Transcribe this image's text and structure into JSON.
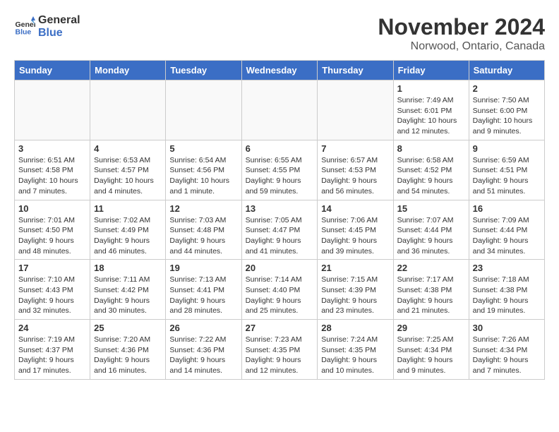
{
  "header": {
    "logo_general": "General",
    "logo_blue": "Blue",
    "title": "November 2024",
    "subtitle": "Norwood, Ontario, Canada"
  },
  "weekdays": [
    "Sunday",
    "Monday",
    "Tuesday",
    "Wednesday",
    "Thursday",
    "Friday",
    "Saturday"
  ],
  "weeks": [
    [
      {
        "day": "",
        "info": ""
      },
      {
        "day": "",
        "info": ""
      },
      {
        "day": "",
        "info": ""
      },
      {
        "day": "",
        "info": ""
      },
      {
        "day": "",
        "info": ""
      },
      {
        "day": "1",
        "info": "Sunrise: 7:49 AM\nSunset: 6:01 PM\nDaylight: 10 hours and 12 minutes."
      },
      {
        "day": "2",
        "info": "Sunrise: 7:50 AM\nSunset: 6:00 PM\nDaylight: 10 hours and 9 minutes."
      }
    ],
    [
      {
        "day": "3",
        "info": "Sunrise: 6:51 AM\nSunset: 4:58 PM\nDaylight: 10 hours and 7 minutes."
      },
      {
        "day": "4",
        "info": "Sunrise: 6:53 AM\nSunset: 4:57 PM\nDaylight: 10 hours and 4 minutes."
      },
      {
        "day": "5",
        "info": "Sunrise: 6:54 AM\nSunset: 4:56 PM\nDaylight: 10 hours and 1 minute."
      },
      {
        "day": "6",
        "info": "Sunrise: 6:55 AM\nSunset: 4:55 PM\nDaylight: 9 hours and 59 minutes."
      },
      {
        "day": "7",
        "info": "Sunrise: 6:57 AM\nSunset: 4:53 PM\nDaylight: 9 hours and 56 minutes."
      },
      {
        "day": "8",
        "info": "Sunrise: 6:58 AM\nSunset: 4:52 PM\nDaylight: 9 hours and 54 minutes."
      },
      {
        "day": "9",
        "info": "Sunrise: 6:59 AM\nSunset: 4:51 PM\nDaylight: 9 hours and 51 minutes."
      }
    ],
    [
      {
        "day": "10",
        "info": "Sunrise: 7:01 AM\nSunset: 4:50 PM\nDaylight: 9 hours and 48 minutes."
      },
      {
        "day": "11",
        "info": "Sunrise: 7:02 AM\nSunset: 4:49 PM\nDaylight: 9 hours and 46 minutes."
      },
      {
        "day": "12",
        "info": "Sunrise: 7:03 AM\nSunset: 4:48 PM\nDaylight: 9 hours and 44 minutes."
      },
      {
        "day": "13",
        "info": "Sunrise: 7:05 AM\nSunset: 4:47 PM\nDaylight: 9 hours and 41 minutes."
      },
      {
        "day": "14",
        "info": "Sunrise: 7:06 AM\nSunset: 4:45 PM\nDaylight: 9 hours and 39 minutes."
      },
      {
        "day": "15",
        "info": "Sunrise: 7:07 AM\nSunset: 4:44 PM\nDaylight: 9 hours and 36 minutes."
      },
      {
        "day": "16",
        "info": "Sunrise: 7:09 AM\nSunset: 4:44 PM\nDaylight: 9 hours and 34 minutes."
      }
    ],
    [
      {
        "day": "17",
        "info": "Sunrise: 7:10 AM\nSunset: 4:43 PM\nDaylight: 9 hours and 32 minutes."
      },
      {
        "day": "18",
        "info": "Sunrise: 7:11 AM\nSunset: 4:42 PM\nDaylight: 9 hours and 30 minutes."
      },
      {
        "day": "19",
        "info": "Sunrise: 7:13 AM\nSunset: 4:41 PM\nDaylight: 9 hours and 28 minutes."
      },
      {
        "day": "20",
        "info": "Sunrise: 7:14 AM\nSunset: 4:40 PM\nDaylight: 9 hours and 25 minutes."
      },
      {
        "day": "21",
        "info": "Sunrise: 7:15 AM\nSunset: 4:39 PM\nDaylight: 9 hours and 23 minutes."
      },
      {
        "day": "22",
        "info": "Sunrise: 7:17 AM\nSunset: 4:38 PM\nDaylight: 9 hours and 21 minutes."
      },
      {
        "day": "23",
        "info": "Sunrise: 7:18 AM\nSunset: 4:38 PM\nDaylight: 9 hours and 19 minutes."
      }
    ],
    [
      {
        "day": "24",
        "info": "Sunrise: 7:19 AM\nSunset: 4:37 PM\nDaylight: 9 hours and 17 minutes."
      },
      {
        "day": "25",
        "info": "Sunrise: 7:20 AM\nSunset: 4:36 PM\nDaylight: 9 hours and 16 minutes."
      },
      {
        "day": "26",
        "info": "Sunrise: 7:22 AM\nSunset: 4:36 PM\nDaylight: 9 hours and 14 minutes."
      },
      {
        "day": "27",
        "info": "Sunrise: 7:23 AM\nSunset: 4:35 PM\nDaylight: 9 hours and 12 minutes."
      },
      {
        "day": "28",
        "info": "Sunrise: 7:24 AM\nSunset: 4:35 PM\nDaylight: 9 hours and 10 minutes."
      },
      {
        "day": "29",
        "info": "Sunrise: 7:25 AM\nSunset: 4:34 PM\nDaylight: 9 hours and 9 minutes."
      },
      {
        "day": "30",
        "info": "Sunrise: 7:26 AM\nSunset: 4:34 PM\nDaylight: 9 hours and 7 minutes."
      }
    ]
  ]
}
